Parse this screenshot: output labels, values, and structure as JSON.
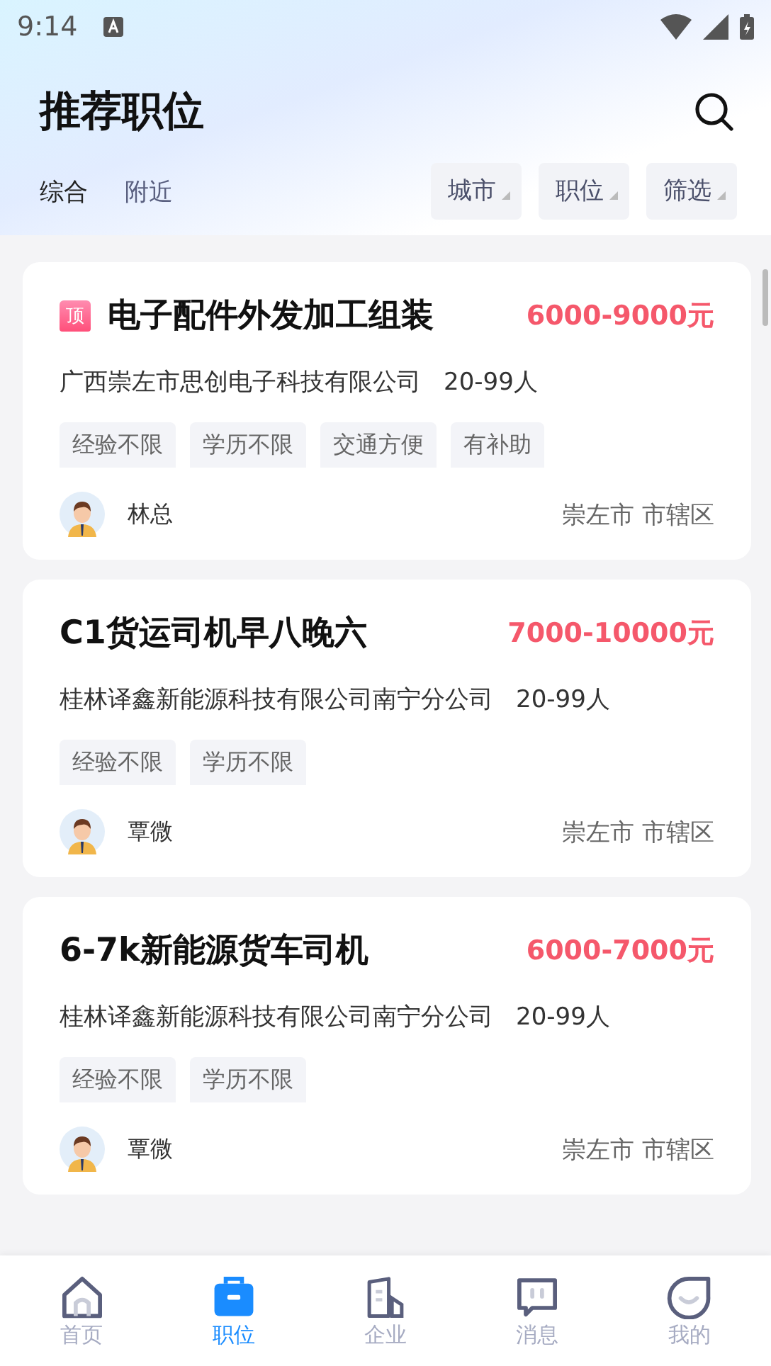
{
  "status_bar": {
    "time": "9:14"
  },
  "header": {
    "title": "推荐职位"
  },
  "sort_tabs": [
    {
      "label": "综合",
      "selected": true
    },
    {
      "label": "附近",
      "selected": false
    }
  ],
  "filters": [
    {
      "label": "城市"
    },
    {
      "label": "职位"
    },
    {
      "label": "筛选"
    }
  ],
  "jobs": [
    {
      "badge": "顶",
      "title": "电子配件外发加工组装",
      "salary": "6000-9000元",
      "company": "广西崇左市思创电子科技有限公司",
      "size": "20-99人",
      "tags": [
        "经验不限",
        "学历不限",
        "交通方便",
        "有补助"
      ],
      "recruiter": "林总",
      "location": "崇左市 市辖区"
    },
    {
      "title": "C1货运司机早八晚六",
      "salary": "7000-10000元",
      "company": "桂林译鑫新能源科技有限公司南宁分公司",
      "size": "20-99人",
      "tags": [
        "经验不限",
        "学历不限"
      ],
      "recruiter": "覃微",
      "location": "崇左市 市辖区"
    },
    {
      "title": "6-7k新能源货车司机",
      "salary": "6000-7000元",
      "company": "桂林译鑫新能源科技有限公司南宁分公司",
      "size": "20-99人",
      "tags": [
        "经验不限",
        "学历不限"
      ],
      "recruiter": "覃微",
      "location": "崇左市 市辖区"
    }
  ],
  "bottom_nav": [
    {
      "kind": "home",
      "label": "首页",
      "selected": false
    },
    {
      "kind": "jobs",
      "label": "职位",
      "selected": true
    },
    {
      "kind": "company",
      "label": "企业",
      "selected": false
    },
    {
      "kind": "messages",
      "label": "消息",
      "selected": false
    },
    {
      "kind": "me",
      "label": "我的",
      "selected": false
    }
  ]
}
